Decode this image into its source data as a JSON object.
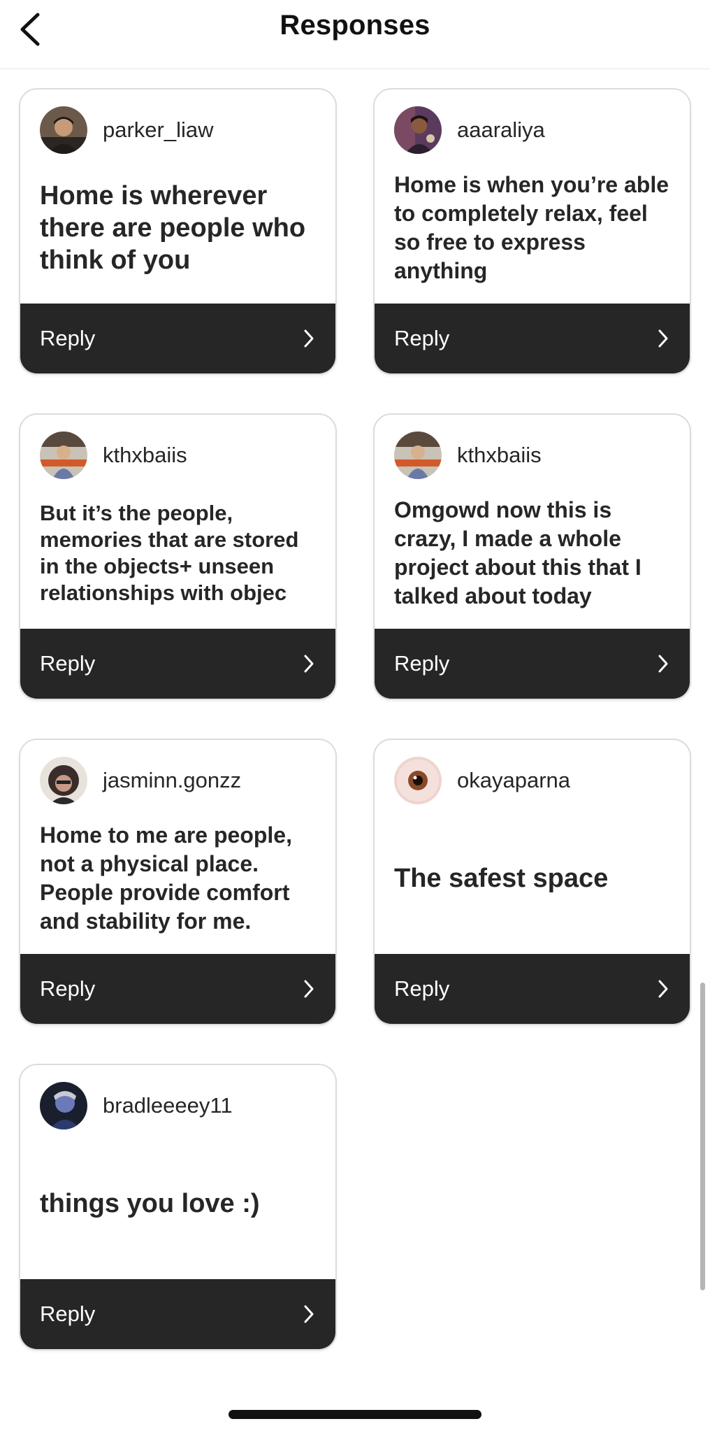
{
  "header": {
    "title": "Responses",
    "back_icon": "chevron-left-icon"
  },
  "responses": [
    {
      "username": "parker_liaw",
      "text": "Home is wherever there are people who think of you",
      "reply_label": "Reply",
      "avatar": "photo-avatar"
    },
    {
      "username": "aaaraliya",
      "text": "Home is when you’re able to completely relax, feel so free to express anything",
      "reply_label": "Reply",
      "avatar": "photo-avatar"
    },
    {
      "username": "kthxbaiis",
      "text": "But it’s the people, memories that are stored in the objects+ unseen relationships with objec",
      "reply_label": "Reply",
      "avatar": "photo-avatar"
    },
    {
      "username": "kthxbaiis",
      "text": "Omgowd now this is crazy, I made a whole project about this that I talked about today",
      "reply_label": "Reply",
      "avatar": "photo-avatar"
    },
    {
      "username": "jasminn.gonzz",
      "text": "Home to me are people, not a physical place. People provide comfort and stability for me.",
      "reply_label": "Reply",
      "avatar": "photo-avatar"
    },
    {
      "username": "okayaparna",
      "text": "The safest space",
      "reply_label": "Reply",
      "avatar": "eye-avatar"
    },
    {
      "username": "bradleeeey11",
      "text": "things you love :)",
      "reply_label": "Reply",
      "avatar": "photo-avatar"
    }
  ],
  "colors": {
    "reply_bar": "#262626",
    "text": "#262626",
    "card_border": "#dcdcdc"
  }
}
